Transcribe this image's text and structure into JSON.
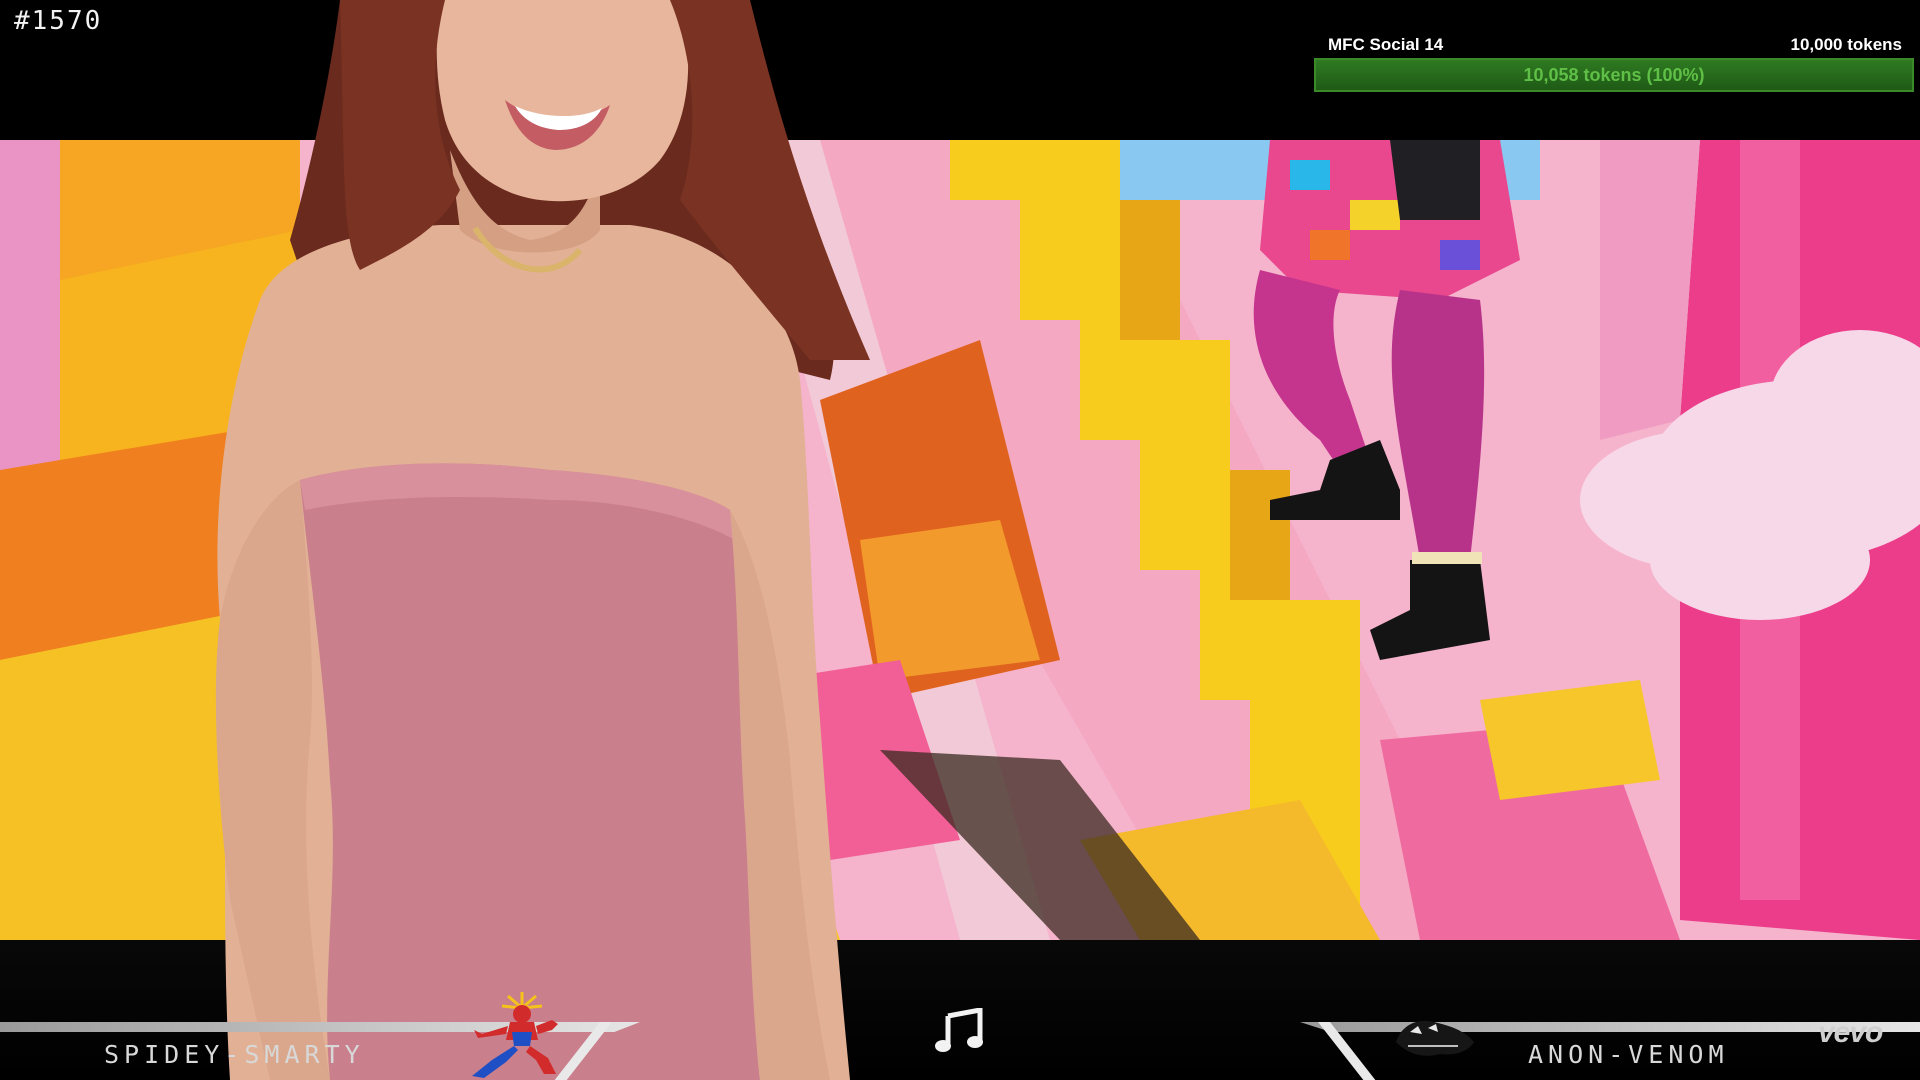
{
  "overlay": {
    "frame_counter": "#1570",
    "vevo_logo": "vevo",
    "music_icon": "music-note-icon"
  },
  "goal": {
    "title": "MFC Social 14",
    "target": "10,000 tokens",
    "progress_text": "10,058 tokens (100%)",
    "progress_fraction": 1.0,
    "bar_color": "#2f7a22",
    "text_color": "#5fbf46"
  },
  "players": {
    "left": {
      "name": "SPIDEY-SMARTY",
      "avatar": "spiderman-icon"
    },
    "right": {
      "name": "ANON-VENOM",
      "avatar": "venom-icon"
    }
  },
  "colors": {
    "scene_pink": "#f3a7c8",
    "scene_yellow": "#f7c21c",
    "scene_magenta": "#e8267a",
    "dress_pink": "#c97f8c"
  }
}
